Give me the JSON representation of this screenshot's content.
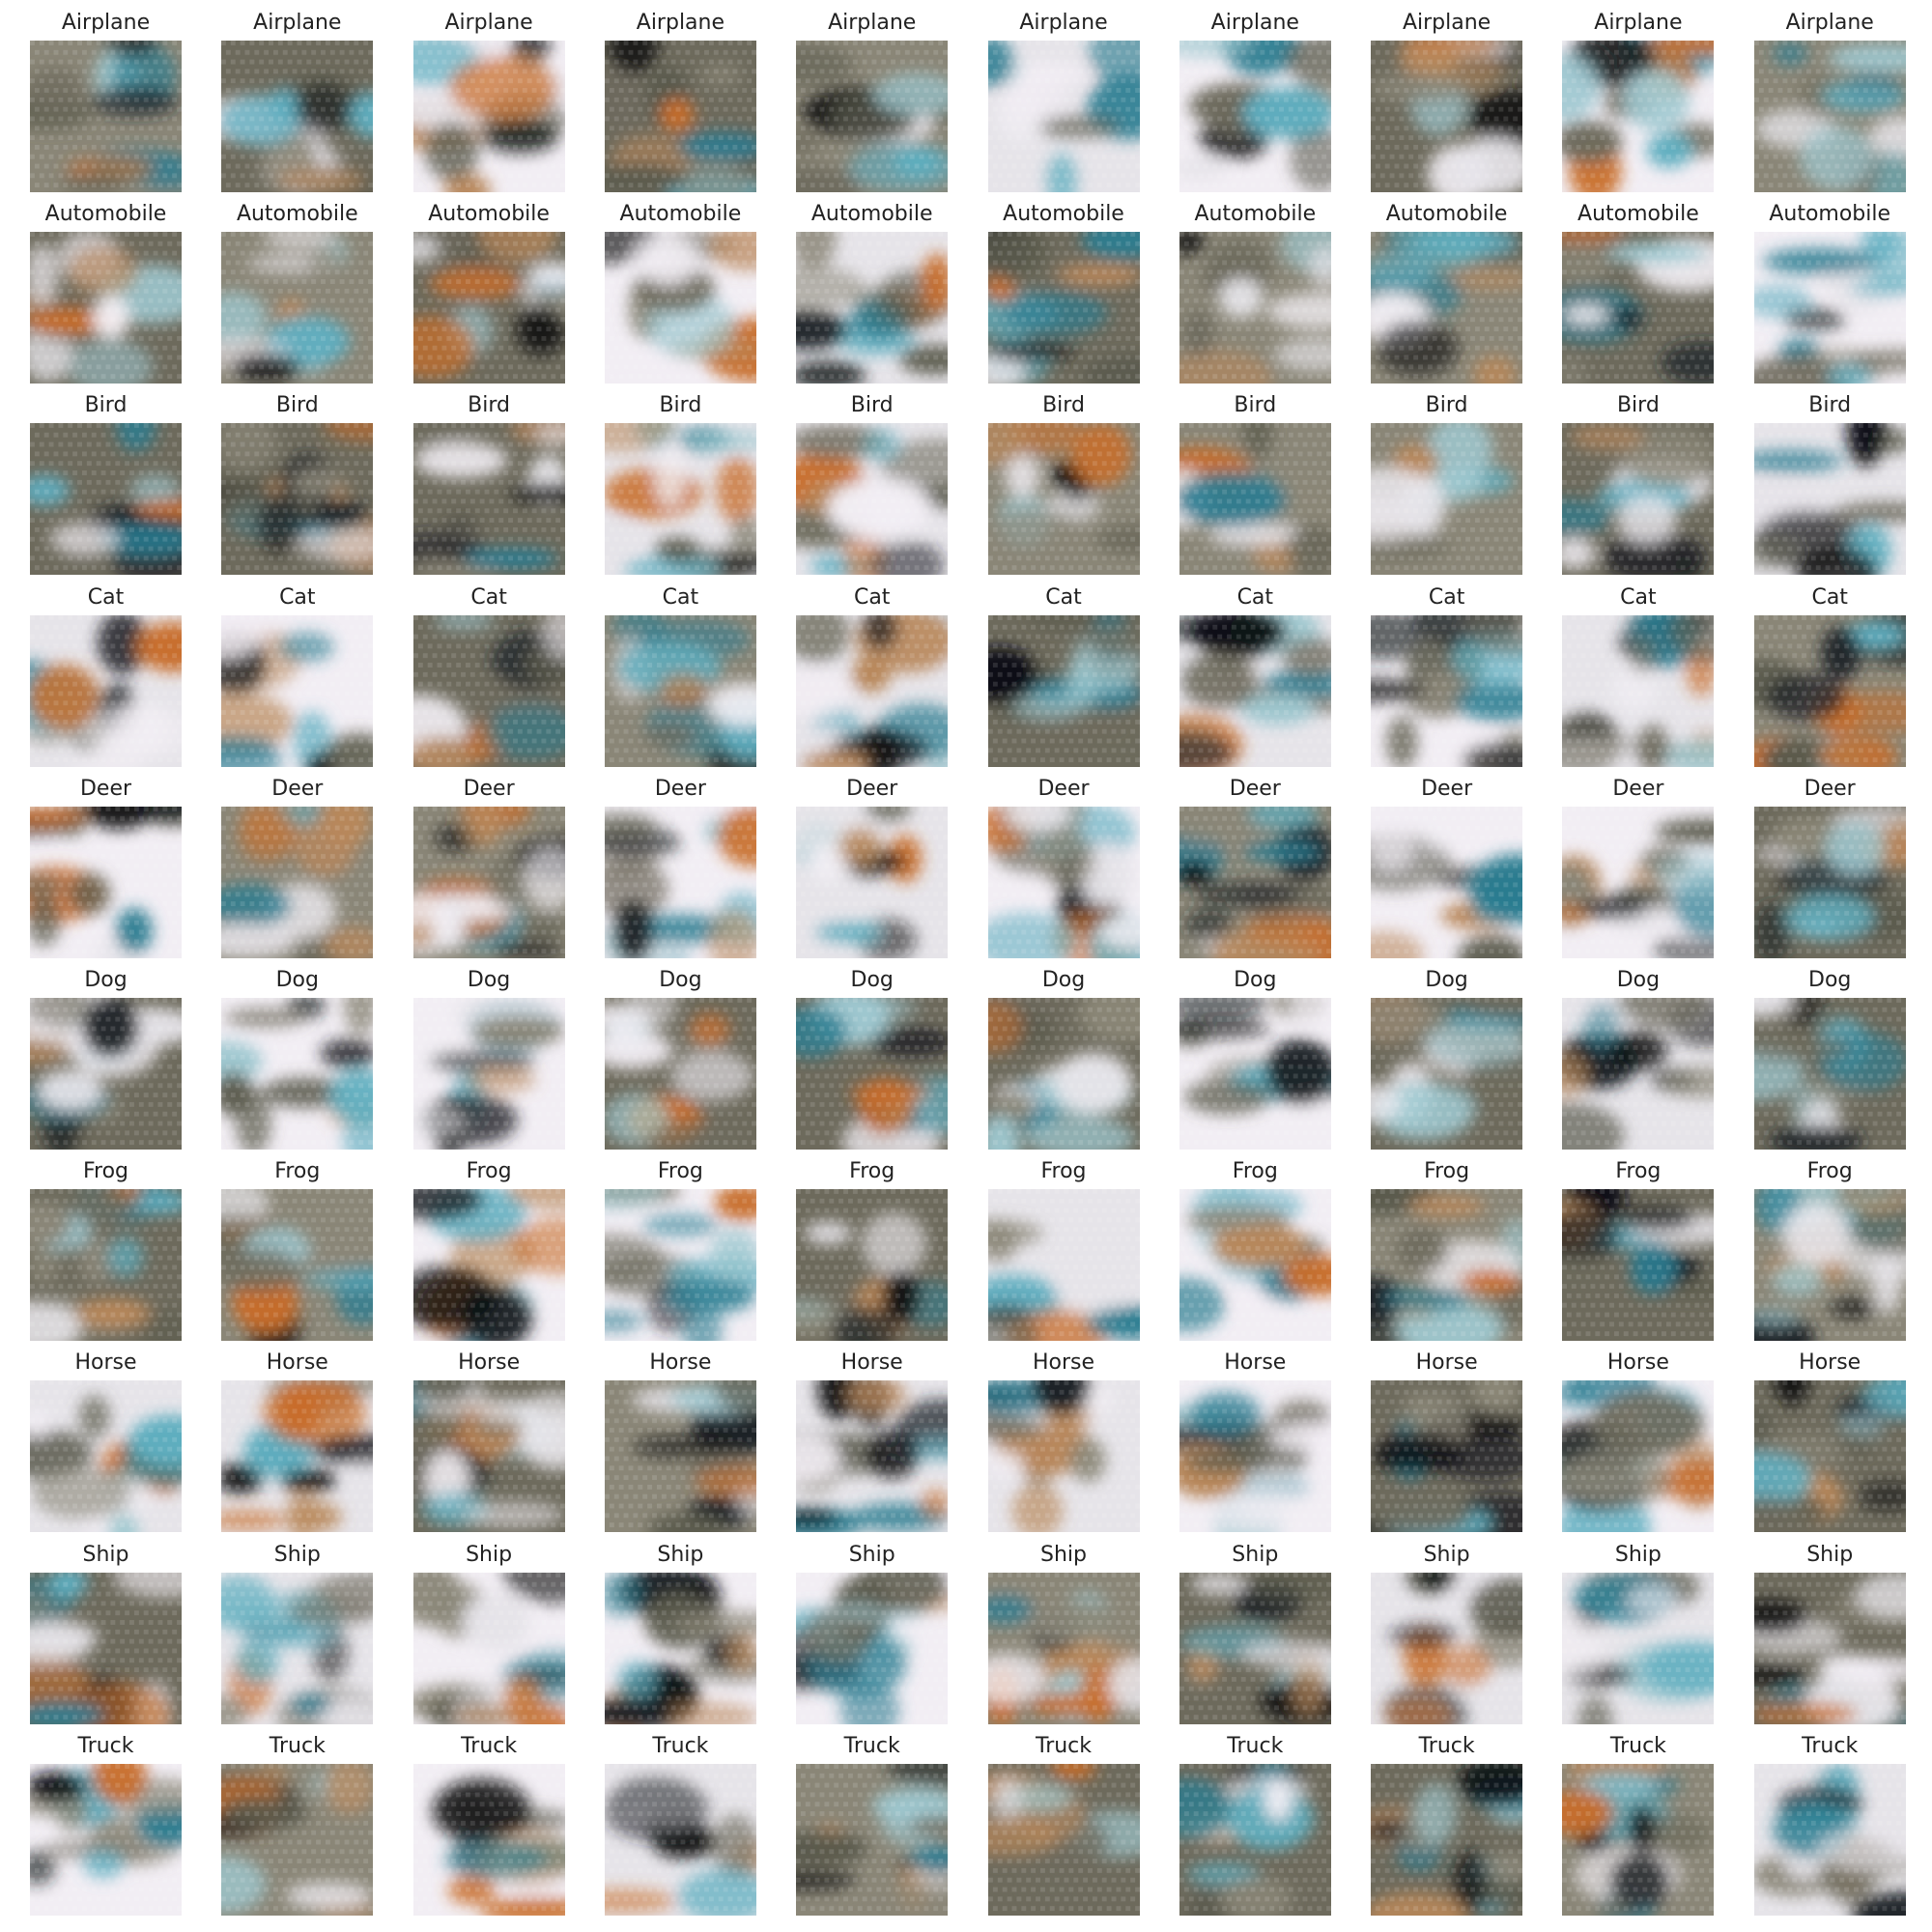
{
  "figure": {
    "rows": [
      {
        "label": "Airplane"
      },
      {
        "label": "Automobile"
      },
      {
        "label": "Bird"
      },
      {
        "label": "Cat"
      },
      {
        "label": "Deer"
      },
      {
        "label": "Dog"
      },
      {
        "label": "Frog"
      },
      {
        "label": "Horse"
      },
      {
        "label": "Ship"
      },
      {
        "label": "Truck"
      }
    ],
    "columns_per_row": 10
  },
  "colors": {
    "background": "#ffffff",
    "label_text": "#222222",
    "palette": [
      "#f2eef4",
      "#e6e4e9",
      "#8a8677",
      "#5a5a4c",
      "#1e2226",
      "#0e1012",
      "#b8875a",
      "#c86d2a",
      "#5faec0",
      "#2a7c90",
      "#9ec8d0",
      "#6d6a5c"
    ]
  }
}
